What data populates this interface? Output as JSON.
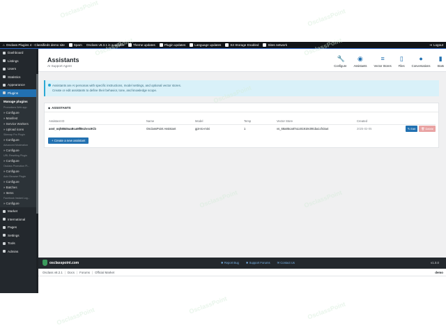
{
  "topbar": {
    "site_title": "Osclass Plugins 4 - Classifieds demo site",
    "items": [
      {
        "icon": "shield-icon",
        "label": "Spam"
      },
      {
        "icon": "info-icon",
        "label": "Osclass v8.3.1 is available"
      },
      {
        "icon": "theme-icon",
        "label": "Theme updates"
      },
      {
        "icon": "plugin-icon",
        "label": "Plugin updates"
      },
      {
        "icon": "language-icon",
        "label": "Language updates"
      },
      {
        "icon": "storage-icon",
        "label": "S3 Storage Enabled"
      },
      {
        "icon": "network-icon",
        "label": "Sites network"
      }
    ],
    "logout": "Logout"
  },
  "sidebar": {
    "items_top": [
      {
        "icon": "dashboard-icon",
        "label": "Dashboard"
      },
      {
        "icon": "listings-icon",
        "label": "Listings"
      },
      {
        "icon": "users-icon",
        "label": "Users"
      },
      {
        "icon": "statistics-icon",
        "label": "Statistics"
      },
      {
        "icon": "appearance-icon",
        "label": "Appearance"
      }
    ],
    "active": {
      "icon": "plugin-icon",
      "label": "Plugins"
    },
    "submenu": {
      "head": "Manage plugins",
      "groups": [
        {
          "title": "Promotions Web app",
          "links": [
            "» Configure",
            "» Manifest",
            "» Service Workers",
            "» Upload icons"
          ]
        },
        {
          "title": "Sitemap Pro Plugin",
          "links": [
            "» Configure"
          ]
        },
        {
          "title": "Advanced Moderation",
          "links": [
            "» Configure"
          ]
        },
        {
          "title": "URL Rewriting Plugin",
          "links": [
            "» Configure"
          ]
        },
        {
          "title": "Osclass Promotion Pl...",
          "links": [
            "» Configure"
          ]
        },
        {
          "title": "Auto Beowse Plugin",
          "links": [
            "» Configure",
            "» Batches",
            "» Items"
          ]
        },
        {
          "title": "Facebook Instant Log...",
          "links": [
            "» Configure"
          ]
        }
      ]
    },
    "items_bottom": [
      {
        "icon": "market-icon",
        "label": "Market"
      },
      {
        "icon": "globe-icon",
        "label": "International"
      },
      {
        "icon": "pages-icon",
        "label": "Pages"
      },
      {
        "icon": "settings-icon",
        "label": "Settings"
      },
      {
        "icon": "tools-icon",
        "label": "Tools"
      },
      {
        "icon": "admins-icon",
        "label": "Admins"
      }
    ]
  },
  "header": {
    "title": "Assistants",
    "subtitle": "AI Support Agent",
    "nav": [
      {
        "icon": "wrench-icon",
        "label": "Configure"
      },
      {
        "icon": "android-icon",
        "label": "Assistants"
      },
      {
        "icon": "database-icon",
        "label": "Vector Stores"
      },
      {
        "icon": "file-icon",
        "label": "Files"
      },
      {
        "icon": "chat-icon",
        "label": "Conversations"
      },
      {
        "icon": "chart-icon",
        "label": "Stats"
      }
    ]
  },
  "notice": {
    "line1": "Assistants are AI personas with specific instructions, model settings, and optional vector stores.",
    "line2": "Create or edit assistants to define their behavior, tone, and knowledge scope."
  },
  "card": {
    "title": "ASSISTANTS",
    "columns": [
      "Assistant ID",
      "Name",
      "Model",
      "Temp",
      "Vector Store",
      "Created"
    ],
    "rows": [
      {
        "id": "asst_oqh8845uaBcaMfBsZvsc9Cb",
        "name": "OsclassPoint Assistant",
        "model": "gpt-4o-mini",
        "temp": "1",
        "vector_store": "vs_68a85ca87a1c81919c091ba1cf43a4",
        "created": "2025-02-05",
        "edit": "Edit",
        "delete": "Delete"
      }
    ],
    "create_label": "Create a new assistant"
  },
  "footer": {
    "logo": "osclasspoint.com",
    "links": [
      "Report Bug",
      "Support Forums",
      "Contact Us"
    ],
    "version": "v1.0.0"
  },
  "bottombar": {
    "crumbs": [
      "Osclass v8.2.1",
      "Docs",
      "Forums",
      "Official Market"
    ],
    "right": "demo"
  },
  "watermark": "OsclassPoint",
  "colors": {
    "accent": "#2271b1",
    "sidebar": "#23282d",
    "notice": "#d9f1f9",
    "delete": "#e9a3a3"
  }
}
